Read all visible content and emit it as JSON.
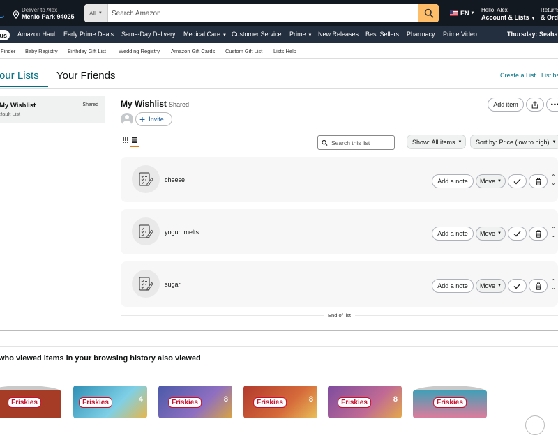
{
  "header": {
    "deliver_line1": "Deliver to Alex",
    "deliver_line2": "Menlo Park 94025",
    "search_category": "All",
    "search_placeholder": "Search Amazon",
    "language": "EN",
    "account_line1": "Hello, Alex",
    "account_line2": "Account & Lists",
    "returns_line1": "Returns",
    "returns_line2": "& Orders"
  },
  "nav2": {
    "prime_pill": "us",
    "items": [
      "Amazon Haul",
      "Early Prime Deals",
      "Same-Day Delivery",
      "Medical Care",
      "Customer Service",
      "Prime",
      "New Releases",
      "Best Sellers",
      "Pharmacy",
      "Prime Video"
    ],
    "promo": "Thursday: Seahav"
  },
  "nav3": {
    "items": [
      "Finder",
      "Baby Registry",
      "Birthday Gift List",
      "Wedding Registry",
      "Amazon Gift Cards",
      "Custom Gift List",
      "Lists Help"
    ]
  },
  "lists": {
    "tab_your_lists": "our Lists",
    "tab_your_friends": "Your Friends",
    "create_list": "Create a List",
    "list_help": "List he"
  },
  "sidebar": {
    "name": "My Wishlist",
    "shared": "Shared",
    "sub": "efault List"
  },
  "main": {
    "title": "My Wishlist",
    "shared": "Shared",
    "add_item": "Add item",
    "invite": "Invite",
    "search_placeholder": "Search this list",
    "show_label": "Show:",
    "show_value": "All items",
    "sort_label": "Sort by:",
    "sort_value": "Price (low to high)",
    "items": [
      {
        "title": "cheese"
      },
      {
        "title": "yogurt melts"
      },
      {
        "title": "sugar"
      }
    ],
    "add_note": "Add a note",
    "move": "Move",
    "end_of_list": "End of list"
  },
  "recommendations": {
    "title": "who viewed items in your browsing history also viewed",
    "products": [
      {
        "brand": "Friskies",
        "color": "#a63b26"
      },
      {
        "brand": "Friskies",
        "color": "#2f8fb5",
        "count": "4"
      },
      {
        "brand": "Friskies",
        "color": "#4a5aa8",
        "count": "8"
      },
      {
        "brand": "Friskies",
        "color": "#b23a2e",
        "count": "8"
      },
      {
        "brand": "Friskies",
        "color": "#7d4c9e",
        "count": "8"
      },
      {
        "brand": "Friskies",
        "color": "#3fa0b8"
      }
    ]
  }
}
